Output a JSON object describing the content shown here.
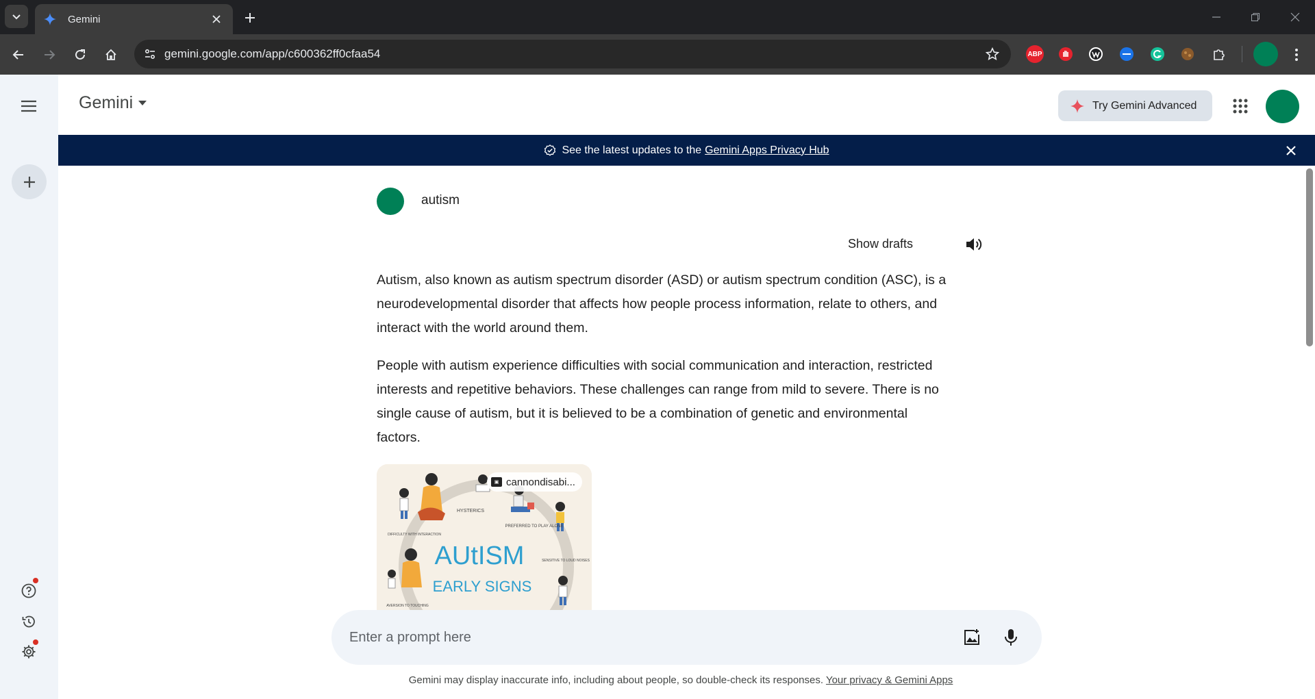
{
  "browser": {
    "tab": {
      "title": "Gemini"
    },
    "url": "gemini.google.com/app/c600362ff0cfaa54",
    "extensions": [
      {
        "name": "adblock-plus",
        "label": "ABP",
        "color": "#e5232e"
      },
      {
        "name": "hand-stop",
        "label": "",
        "color": "#e5232e"
      },
      {
        "name": "wappalyzer",
        "label": "",
        "color": "#ffffff"
      },
      {
        "name": "blue-ext",
        "label": "",
        "color": "#1a73e8"
      },
      {
        "name": "grammarly",
        "label": "",
        "color": "#15c39a"
      },
      {
        "name": "brown-ext",
        "label": "",
        "color": "#8b5a2b"
      },
      {
        "name": "puzzle",
        "label": "",
        "color": "#c4c7c5"
      }
    ]
  },
  "header": {
    "brand": "Gemini",
    "try_advanced": "Try Gemini Advanced"
  },
  "banner": {
    "text": "See the latest updates to the",
    "link": "Gemini Apps Privacy Hub"
  },
  "conversation": {
    "user_query": "autism",
    "show_drafts": "Show drafts",
    "paragraphs": [
      "Autism, also known as autism spectrum disorder (ASD) or autism spectrum condition (ASC), is a neurodevelopmental disorder that affects how people process information, relate to others, and interact with the world around them.",
      "People with autism experience difficulties with social communication and interaction, restricted interests and repetitive behaviors. These challenges can range from mild to severe. There is no single cause of autism, but it is believed to be a combination of genetic and environmental factors."
    ],
    "image": {
      "source": "cannondisabi...",
      "title_line1": "AUtISM",
      "title_line2": "EARLY SIGNS",
      "captions": [
        "HYSTERICS",
        "PREFERRED TO PLAY ALONE",
        "DIFFICULTY WITH INTERACTION",
        "SENSITIVE TO LOUD NOISES",
        "AVERSION TO TOUCHING"
      ]
    }
  },
  "prompt": {
    "placeholder": "Enter a prompt here"
  },
  "footer": {
    "disclaimer": "Gemini may display inaccurate info, including about people, so double-check its responses.",
    "privacy_link": "Your privacy & Gemini Apps"
  },
  "colors": {
    "accent_green": "#008056",
    "banner_bg": "#041e49",
    "rail_bg": "#f0f4f9"
  }
}
